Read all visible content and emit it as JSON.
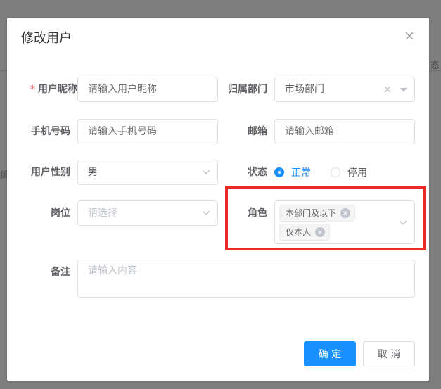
{
  "background": {
    "fragment_left": "编",
    "fragment_right": "态"
  },
  "dialog": {
    "title": "修改用户",
    "close_icon": "close-icon"
  },
  "form": {
    "nickname": {
      "label": "用户昵称",
      "required_mark": "*",
      "placeholder": "请输入用户昵称",
      "value": ""
    },
    "department": {
      "label": "归属部门",
      "value": "市场部门"
    },
    "phone": {
      "label": "手机号码",
      "placeholder": "请输入手机号码",
      "value": ""
    },
    "email": {
      "label": "邮箱",
      "placeholder": "请输入邮箱",
      "value": ""
    },
    "gender": {
      "label": "用户性别",
      "value": "男"
    },
    "status": {
      "label": "状态",
      "options": [
        "正常",
        "停用"
      ],
      "selected": "正常"
    },
    "post": {
      "label": "岗位",
      "placeholder": "请选择",
      "value": ""
    },
    "role": {
      "label": "角色",
      "tags": [
        "本部门及以下",
        "仅本人"
      ]
    },
    "remark": {
      "label": "备注",
      "placeholder": "请输入内容",
      "value": ""
    }
  },
  "footer": {
    "confirm": "确 定",
    "cancel": "取 消"
  },
  "colors": {
    "primary": "#1890ff",
    "highlight": "#ec2a2a",
    "required": "#f56c6c"
  }
}
